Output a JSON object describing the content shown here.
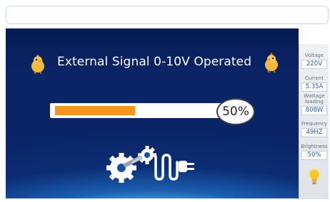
{
  "screen": {
    "title": "External Signal 0-10V Operated",
    "progress_value": 0.5,
    "progress_label": "50%"
  },
  "side_panel": {
    "stats": [
      {
        "label": "Voltage",
        "value": "220V"
      },
      {
        "label": "Current",
        "value": "5.35A"
      },
      {
        "label": "Wattage loading",
        "value": "808W"
      },
      {
        "label": "Frequency",
        "value": "49HZ"
      },
      {
        "label": "Brightness",
        "value": "50%"
      }
    ]
  },
  "icons": [
    "chick-icon",
    "gear-plug-logo-icon",
    "light-bulb-icon"
  ],
  "colors": {
    "progress_fill": "#f79420",
    "background_dark": "#0a2466",
    "background_light": "#6fc0ef",
    "value_text": "#2c5eaa"
  }
}
